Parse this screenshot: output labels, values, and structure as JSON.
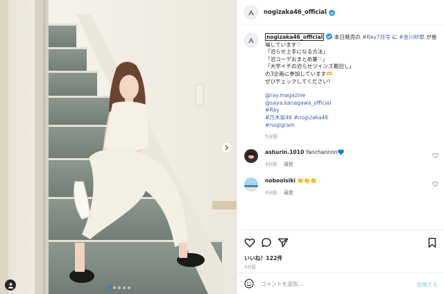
{
  "header": {
    "username": "nogizaka46_official"
  },
  "caption": {
    "username": "nogizaka46_official",
    "line1_text": "本日発売の",
    "line1_link1": "#Ray7月号",
    "line1_mid": "に",
    "line1_link2": "#金川紗耶",
    "line1_end": "が登",
    "line2": "場しています♡",
    "lines": [
      "「沼らせ上手になる方法」",
      "「沼コーデおまとめ集♡」",
      "「大学イチの沼らせツインズ着回し」",
      "の3企画に参加しています🫶",
      "ぜひチェックしてください！"
    ],
    "mentions": [
      "@ray.magazine",
      "@saya.kanagawa_official",
      "#Ray",
      "#乃木坂46 #nogizaka46",
      "#nogigram"
    ],
    "time": "5分前"
  },
  "comments": [
    {
      "username": "ashurin.1010",
      "text": "Yanchannnn💙",
      "time": "3分前",
      "reply": "返信"
    },
    {
      "username": "noboolsiki",
      "text": "👏👏👏",
      "time": "4分前",
      "reply": "返信"
    }
  ],
  "stats": {
    "likes": "いいね！122件",
    "posted": "5分前"
  },
  "composer": {
    "placeholder": "コメントを追加...",
    "post_label": "投稿する"
  },
  "carousel": {
    "slides": 5,
    "active": 1
  },
  "colors": {
    "link": "#3f5da8",
    "verified": "#3897f0",
    "muted": "#8e8e8e",
    "post_btn": "#b2dffc"
  }
}
